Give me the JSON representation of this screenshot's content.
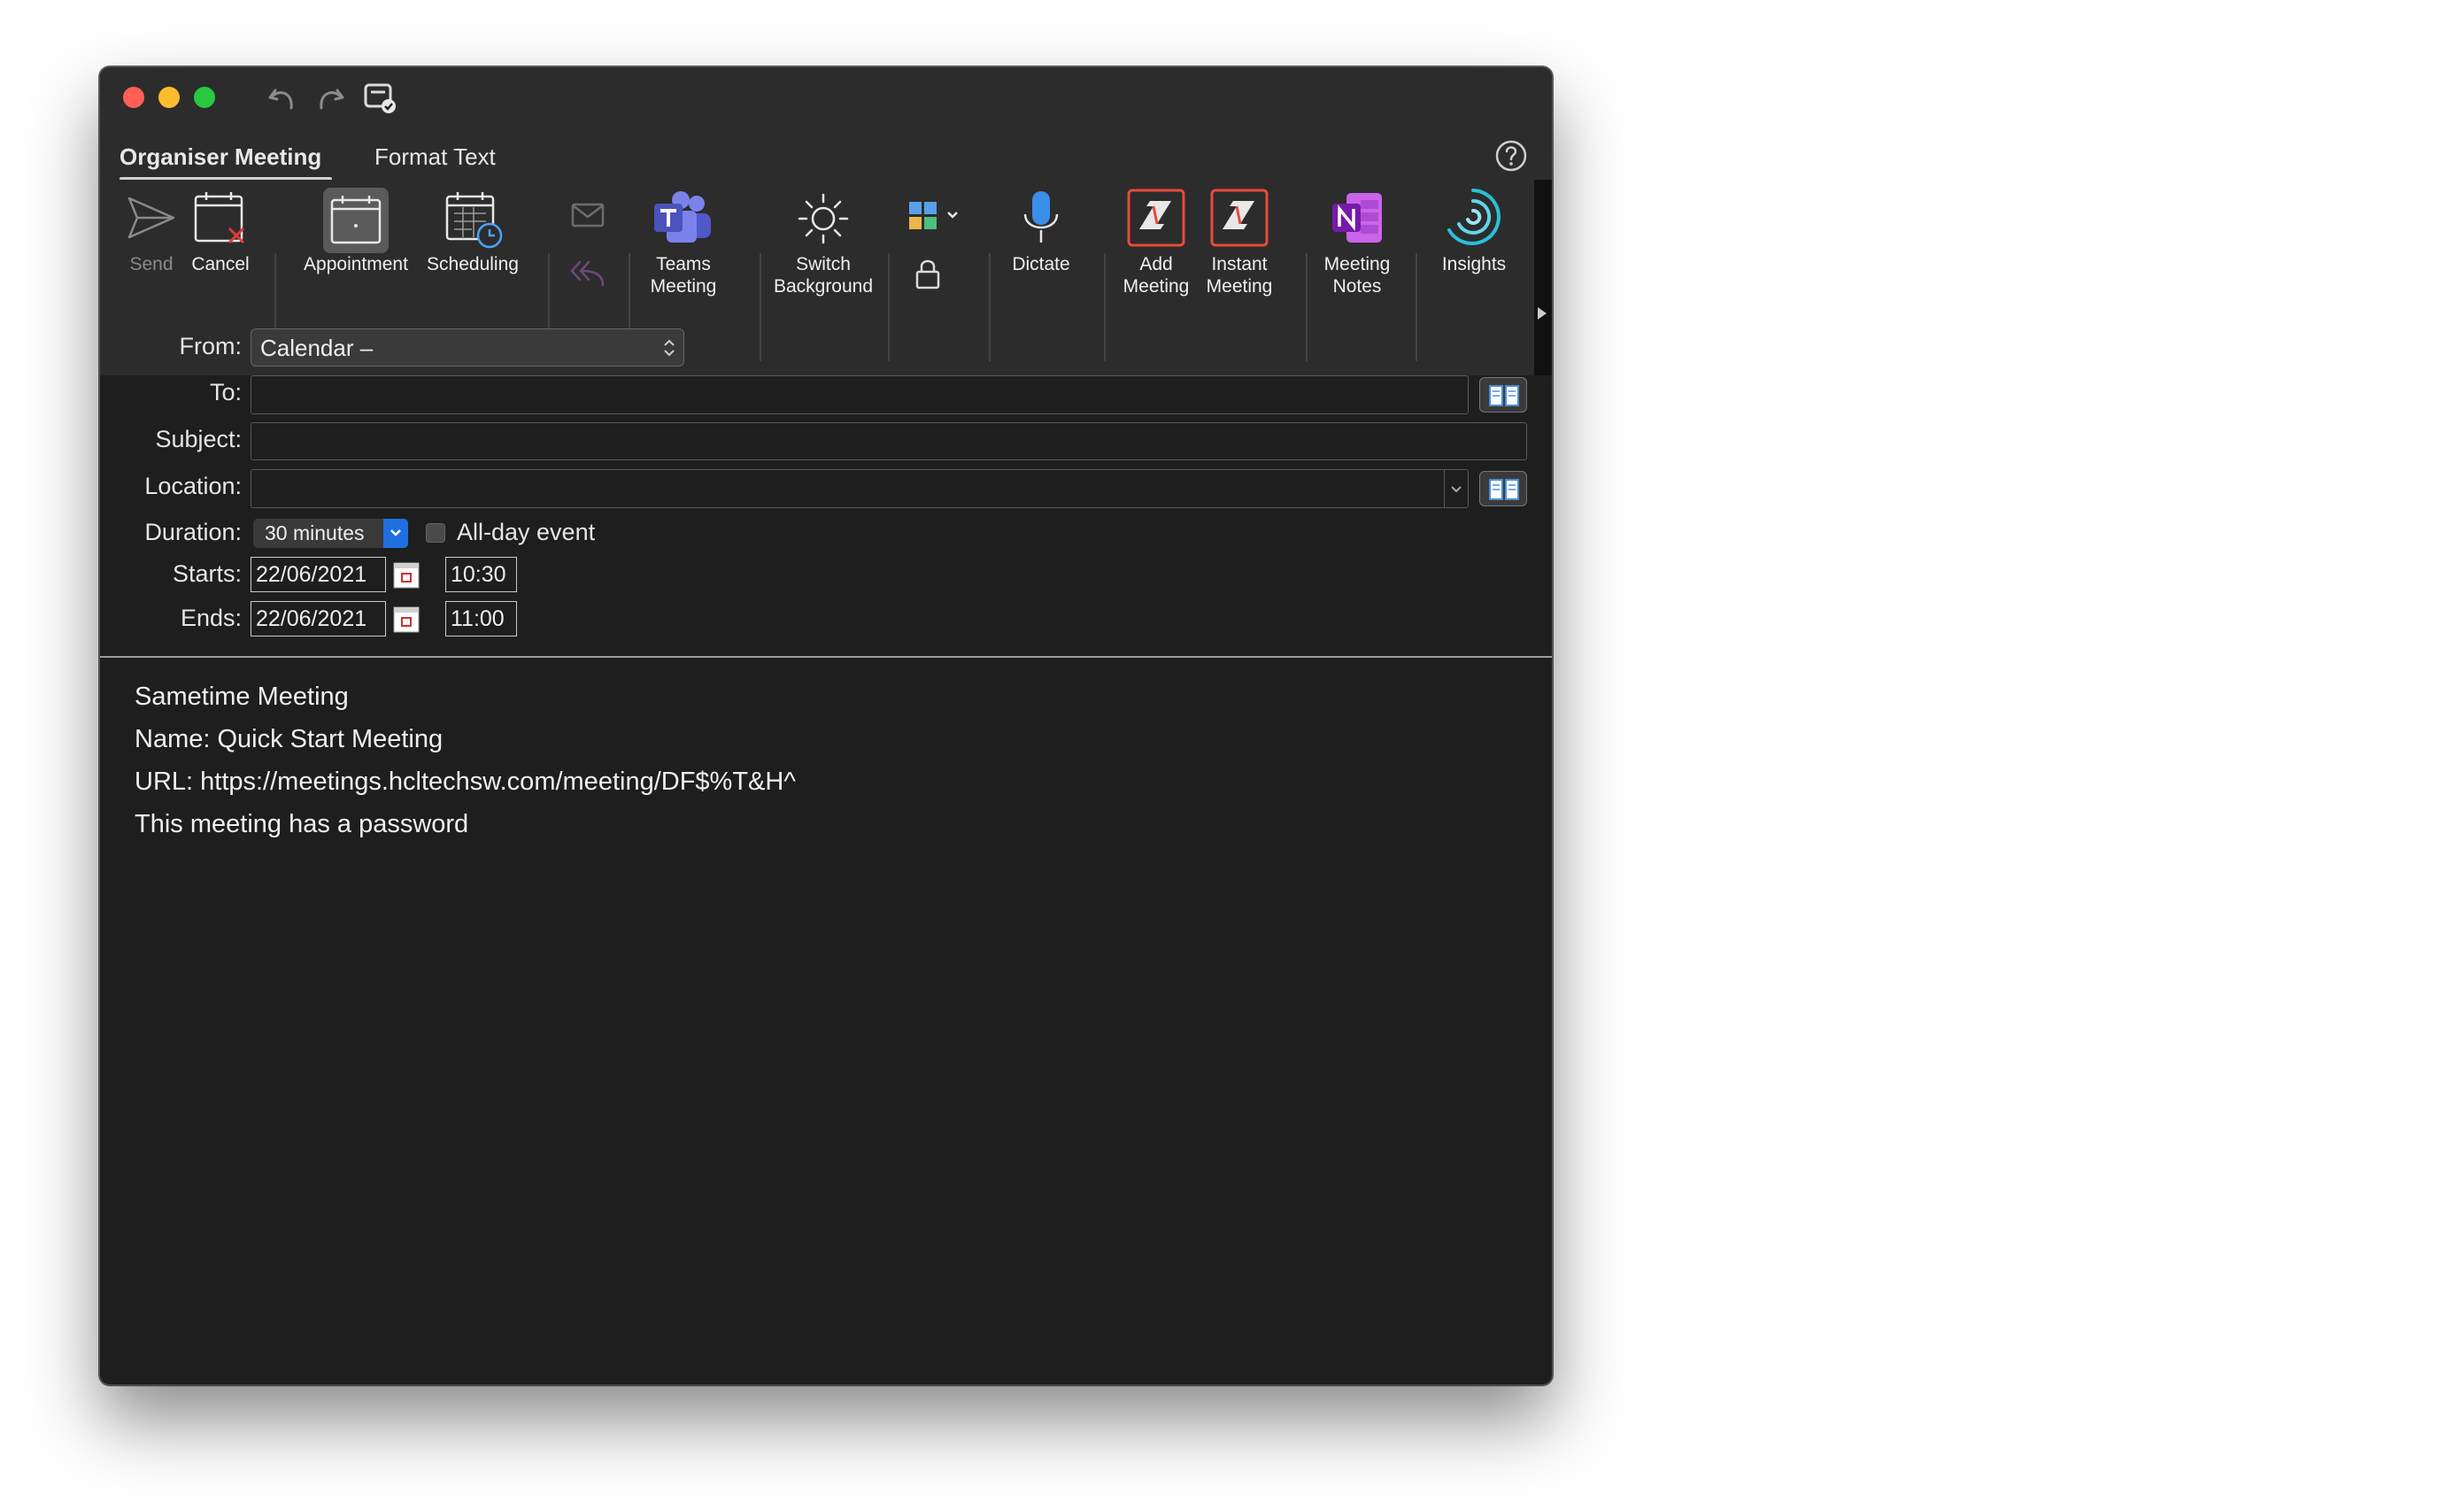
{
  "window": {
    "tabs": [
      {
        "label": "Organiser Meeting",
        "active": true
      },
      {
        "label": "Format Text",
        "active": false
      }
    ]
  },
  "toolbar": {
    "send": "Send",
    "cancel": "Cancel",
    "appointment": "Appointment",
    "scheduling": "Scheduling",
    "teams_1": "Teams",
    "teams_2": "Meeting",
    "switch_1": "Switch",
    "switch_2": "Background",
    "dictate": "Dictate",
    "add_1": "Add",
    "add_2": "Meeting",
    "instant_1": "Instant",
    "instant_2": "Meeting",
    "notes_1": "Meeting",
    "notes_2": "Notes",
    "insights": "Insights"
  },
  "form": {
    "from_label": "From:",
    "from_value": "Calendar –",
    "to_label": "To:",
    "subject_label": "Subject:",
    "location_label": "Location:",
    "duration_label": "Duration:",
    "duration_value": "30 minutes",
    "allday_label": "All-day event",
    "allday_checked": false,
    "starts_label": "Starts:",
    "start_date": "22/06/2021",
    "start_time": "10:30",
    "ends_label": "Ends:",
    "end_date": "22/06/2021",
    "end_time": "11:00"
  },
  "body": {
    "lines": [
      "Sametime Meeting",
      "Name: Quick Start Meeting",
      "URL: https://meetings.hcltechsw.com/meeting/DF$%T&H^",
      "This meeting has a password"
    ]
  },
  "colors": {
    "window_bg": "#1e1e1e",
    "toolbar_bg": "#2c2c2c",
    "accent_blue": "#1f6fe0",
    "close": "#fe5f57",
    "minimize": "#febc2e",
    "maximize": "#28c840"
  }
}
